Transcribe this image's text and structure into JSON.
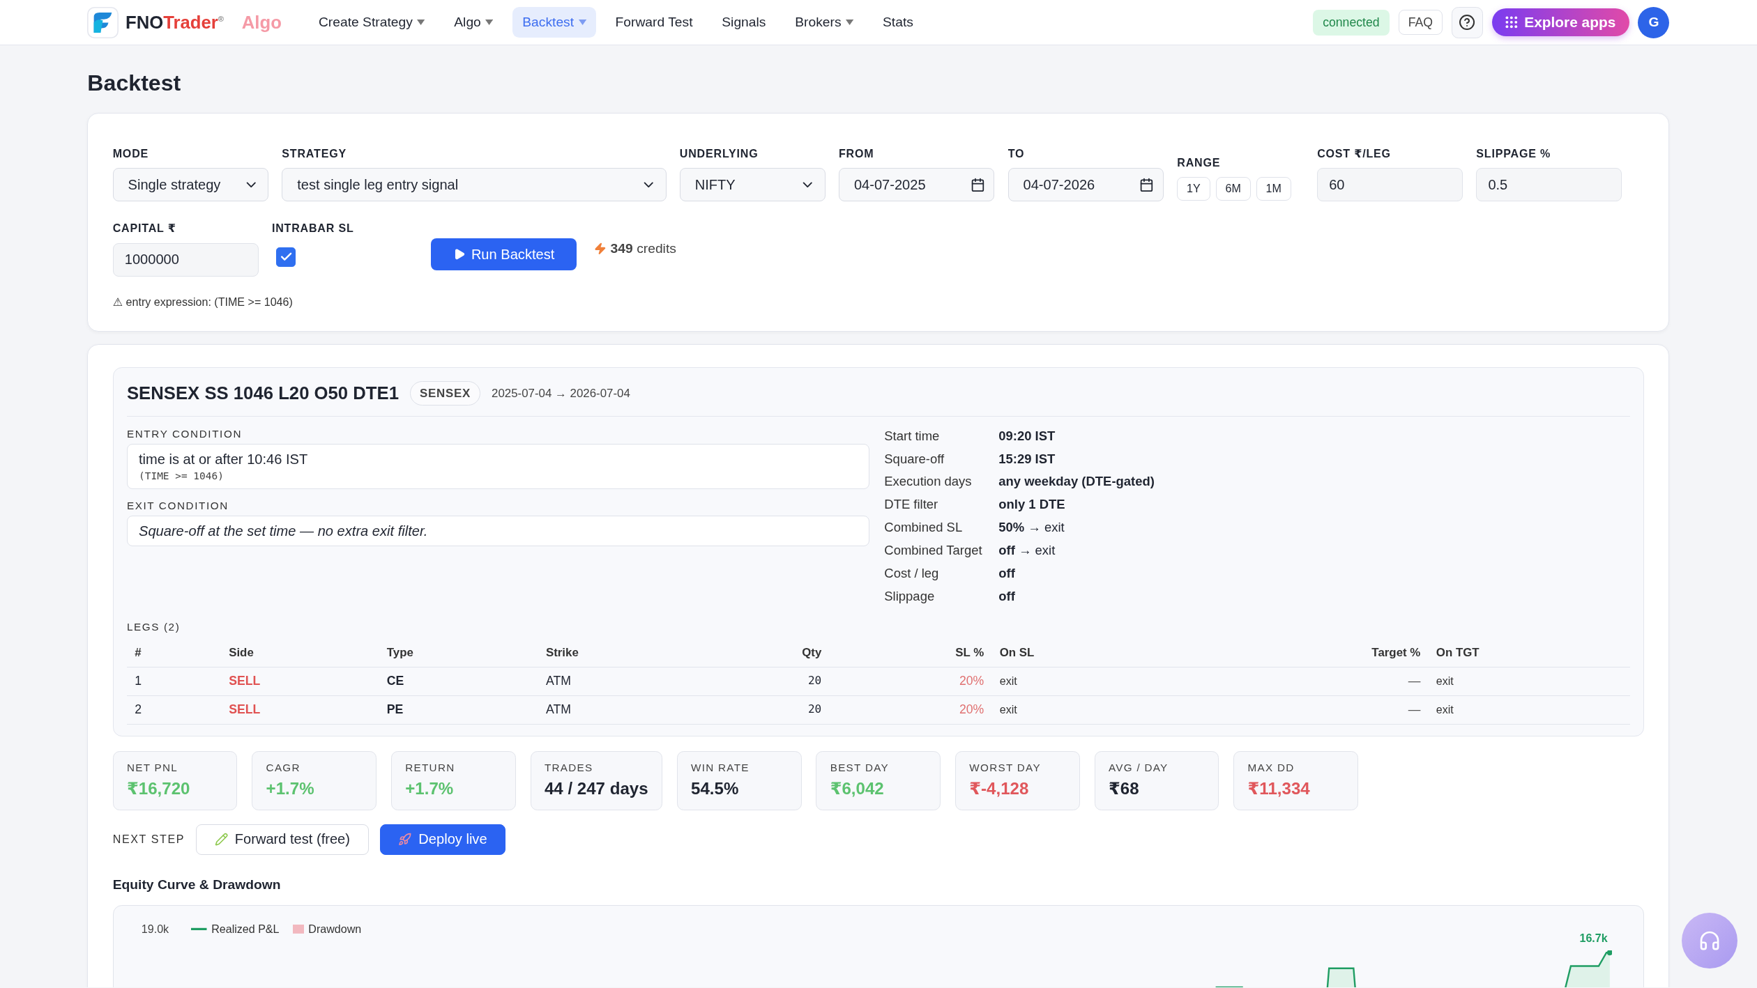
{
  "nav": {
    "brand": {
      "first": "FNO",
      "second": "Trader",
      "mark": "®",
      "product": "Algo"
    },
    "items": [
      {
        "label": "Create Strategy",
        "dropdown": true,
        "selected": false
      },
      {
        "label": "Algo",
        "dropdown": true,
        "selected": false
      },
      {
        "label": "Backtest",
        "dropdown": true,
        "selected": true
      },
      {
        "label": "Forward Test",
        "dropdown": false,
        "selected": false
      },
      {
        "label": "Signals",
        "dropdown": false,
        "selected": false
      },
      {
        "label": "Brokers",
        "dropdown": true,
        "selected": false
      },
      {
        "label": "Stats",
        "dropdown": false,
        "selected": false
      }
    ],
    "status": "connected",
    "faq": "FAQ",
    "explore": "Explore apps",
    "avatar": "G"
  },
  "page_title": "Backtest",
  "form": {
    "row_1": [
      {
        "kind": "select",
        "label": "MODE",
        "value": "Single strategy"
      },
      {
        "kind": "select",
        "label": "STRATEGY",
        "value": "test single leg entry signal"
      },
      {
        "kind": "select",
        "label": "UNDERLYING",
        "value": "NIFTY"
      },
      {
        "kind": "date",
        "label": "FROM",
        "value": "04-07-2025"
      },
      {
        "kind": "date",
        "label": "TO",
        "value": "04-07-2026"
      },
      {
        "kind": "range",
        "label": "RANGE",
        "options": [
          "1Y",
          "6M",
          "1M"
        ]
      },
      {
        "kind": "input",
        "label": "COST ₹/LEG",
        "value": "60"
      },
      {
        "kind": "input",
        "label": "SLIPPAGE %",
        "value": "0.5"
      }
    ],
    "row_2": [
      {
        "kind": "input",
        "label": "CAPITAL ₹",
        "value": "1000000"
      },
      {
        "kind": "checkbox",
        "label": "INTRABAR SL",
        "checked": true
      }
    ],
    "run_button": "Run Backtest",
    "credits": {
      "amount": "349",
      "label": "credits"
    },
    "warning": "⚠ entry expression: (TIME >= 1046)"
  },
  "result": {
    "title": "SENSEX SS 1046 L20 O50 DTE1",
    "badge": "SENSEX",
    "dates": "2025-07-04 → 2026-07-04",
    "entry": {
      "label": "ENTRY CONDITION",
      "text": "time is at or after 10:46 IST",
      "code": "(TIME >= 1046)"
    },
    "exit": {
      "label": "EXIT CONDITION",
      "text": "Square-off at the set time — no extra exit filter."
    },
    "details": [
      {
        "label": "Start time",
        "value": "09:20 IST"
      },
      {
        "label": "Square-off",
        "value": "15:29 IST"
      },
      {
        "label": "Execution days",
        "value": "any weekday (DTE-gated)"
      },
      {
        "label": "DTE filter",
        "value": "only 1 DTE"
      },
      {
        "label": "Combined SL",
        "value": "50%",
        "note": "→ exit"
      },
      {
        "label": "Combined Target",
        "value": "off",
        "note": "→ exit"
      },
      {
        "label": "Cost / leg",
        "value": "off"
      },
      {
        "label": "Slippage",
        "value": "off"
      }
    ],
    "legs": {
      "label": "LEGS (2)",
      "columns": [
        {
          "label": "#",
          "kind": "plain"
        },
        {
          "label": "Side",
          "kind": "side"
        },
        {
          "label": "Type",
          "kind": "bold"
        },
        {
          "label": "Strike",
          "kind": "plain"
        },
        {
          "label": "Qty",
          "kind": "mono"
        },
        {
          "label": "SL %",
          "kind": "pct"
        },
        {
          "label": "On SL",
          "kind": "small"
        },
        {
          "label": "Target %",
          "kind": "dash"
        },
        {
          "label": "On TGT",
          "kind": "small"
        }
      ],
      "rows": [
        [
          "1",
          "SELL",
          "CE",
          "ATM",
          "20",
          "20%",
          "exit",
          "—",
          "exit"
        ],
        [
          "2",
          "SELL",
          "PE",
          "ATM",
          "20",
          "20%",
          "exit",
          "—",
          "exit"
        ]
      ]
    }
  },
  "stats": [
    {
      "label": "NET PNL",
      "value": "₹16,720",
      "color": "#5cc26f"
    },
    {
      "label": "CAGR",
      "value": "+1.7%",
      "color": "#5cc26f"
    },
    {
      "label": "RETURN",
      "value": "+1.7%",
      "color": "#5cc26f"
    },
    {
      "label": "TRADES",
      "value": "44 / 247 days",
      "color": "#1f2430"
    },
    {
      "label": "WIN RATE",
      "value": "54.5%",
      "color": "#1f2430"
    },
    {
      "label": "BEST DAY",
      "value": "₹6,042",
      "color": "#5cc26f"
    },
    {
      "label": "WORST DAY",
      "value": "₹-4,128",
      "color": "#e0575b"
    },
    {
      "label": "AVG / DAY",
      "value": "₹68",
      "color": "#1f2430"
    },
    {
      "label": "MAX DD",
      "value": "₹11,334",
      "color": "#e0575b"
    }
  ],
  "next_step": {
    "label": "NEXT STEP",
    "buttons": [
      {
        "label": "Forward test (free)",
        "kind": "outline"
      },
      {
        "label": "Deploy live",
        "kind": "primary"
      }
    ]
  },
  "chart": {
    "title": "Equity Curve & Drawdown",
    "y_tick": "19.0k",
    "end_label": "16.7k",
    "legend": [
      {
        "label": "Realized P&L",
        "kind": "line",
        "color": "#1f9d63"
      },
      {
        "label": "Drawdown",
        "kind": "area",
        "color": "#f2b8bf"
      }
    ]
  }
}
